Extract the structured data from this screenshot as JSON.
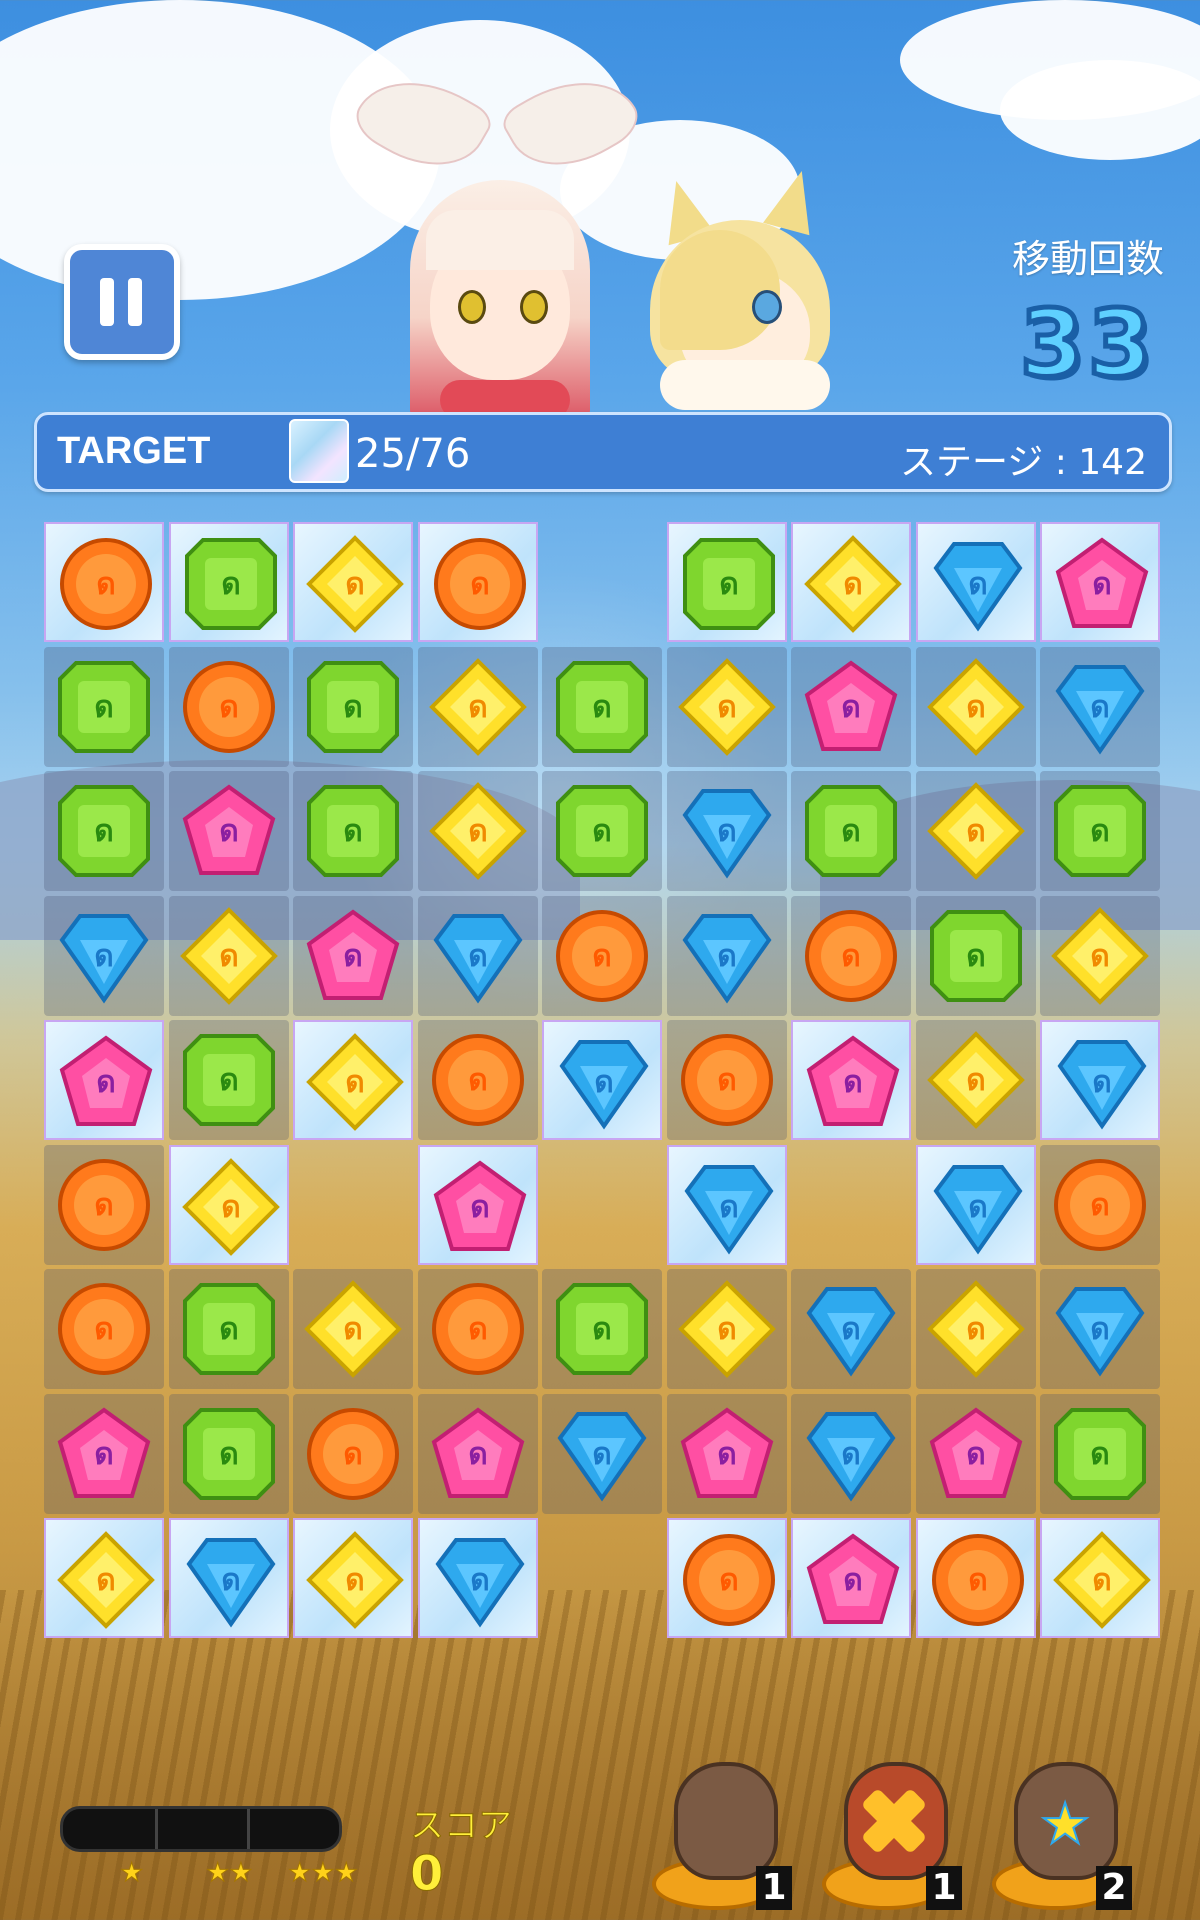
{
  "hud": {
    "moves_label": "移動回数",
    "moves_value": "33",
    "target_label": "TARGET",
    "target_count": "25/76",
    "stage_label": "ステージ : 142"
  },
  "board": {
    "rows": [
      [
        "orange",
        "green",
        "yellow",
        "orange",
        null,
        "green",
        "yellow",
        "blue",
        "pink"
      ],
      [
        "green",
        "orange",
        "green",
        "yellow",
        "green",
        "yellow",
        "pink",
        "yellow",
        "blue"
      ],
      [
        "green",
        "pink",
        "green",
        "yellow",
        "green",
        "blue",
        "green",
        "yellow",
        "green"
      ],
      [
        "blue",
        "yellow",
        "pink",
        "blue",
        "orange",
        "blue",
        "orange",
        "green",
        "yellow"
      ],
      [
        "pink",
        "green",
        "yellow",
        "orange",
        "blue",
        "orange",
        "pink",
        "yellow",
        "blue"
      ],
      [
        "orange",
        "yellow",
        null,
        "pink",
        null,
        "blue",
        null,
        "blue",
        "orange"
      ],
      [
        "orange",
        "green",
        "yellow",
        "orange",
        "green",
        "yellow",
        "blue",
        "yellow",
        "blue"
      ],
      [
        "pink",
        "green",
        "orange",
        "pink",
        "blue",
        "pink",
        "blue",
        "pink",
        "green"
      ],
      [
        "yellow",
        "blue",
        "yellow",
        "blue",
        null,
        "orange",
        "pink",
        "orange",
        "yellow"
      ]
    ],
    "ice": [
      [
        true,
        true,
        true,
        true,
        false,
        true,
        true,
        true,
        true
      ],
      [
        false,
        false,
        false,
        false,
        false,
        false,
        false,
        false,
        false
      ],
      [
        false,
        false,
        false,
        false,
        false,
        false,
        false,
        false,
        false
      ],
      [
        false,
        false,
        false,
        false,
        false,
        false,
        false,
        false,
        false
      ],
      [
        true,
        false,
        true,
        false,
        true,
        false,
        true,
        false,
        true
      ],
      [
        false,
        true,
        false,
        true,
        false,
        true,
        false,
        true,
        false
      ],
      [
        false,
        false,
        false,
        false,
        false,
        false,
        false,
        false,
        false
      ],
      [
        false,
        false,
        false,
        false,
        false,
        false,
        false,
        false,
        false
      ],
      [
        true,
        true,
        true,
        true,
        false,
        true,
        true,
        true,
        true
      ]
    ]
  },
  "footer": {
    "score_label": "スコア",
    "score_value": "0",
    "stars": [
      "★",
      "★★",
      "★★★"
    ],
    "items": [
      {
        "name": "paw-item",
        "count": "1"
      },
      {
        "name": "cross-paw-item",
        "count": "1"
      },
      {
        "name": "star-paw-item",
        "count": "2"
      }
    ]
  },
  "colors": {
    "orange": "#ff7a1c",
    "green": "#7fd62e",
    "yellow": "#ffe02a",
    "blue": "#2ea9ee",
    "pink": "#ff4fa3"
  }
}
